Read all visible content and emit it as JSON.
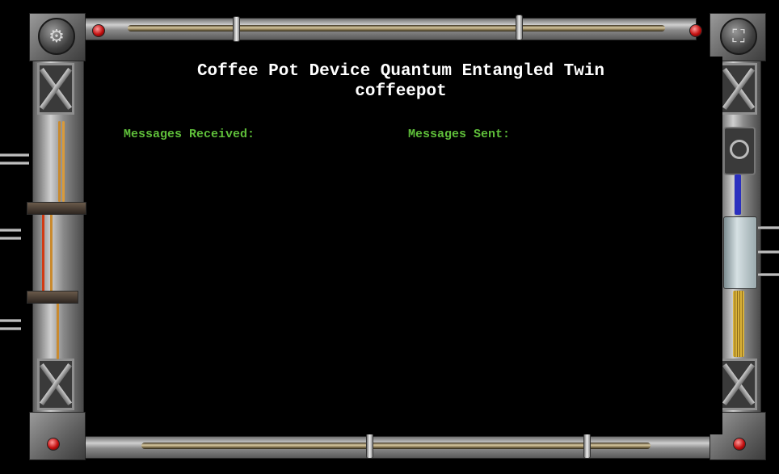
{
  "title": {
    "line1": "Coffee Pot Device Quantum Entangled Twin",
    "line2": "coffeepot"
  },
  "columns": {
    "received_label": "Messages Received:",
    "sent_label": "Messages Sent:",
    "received": [],
    "sent": []
  },
  "controls": {
    "settings_icon": "gear-icon",
    "fullscreen_icon": "expand-icon",
    "settings_glyph": "⚙",
    "fullscreen_glyph": "⛶"
  },
  "colors": {
    "label_green": "#5fbf3a",
    "title_white": "#ffffff",
    "led_red": "#c20f0f"
  }
}
